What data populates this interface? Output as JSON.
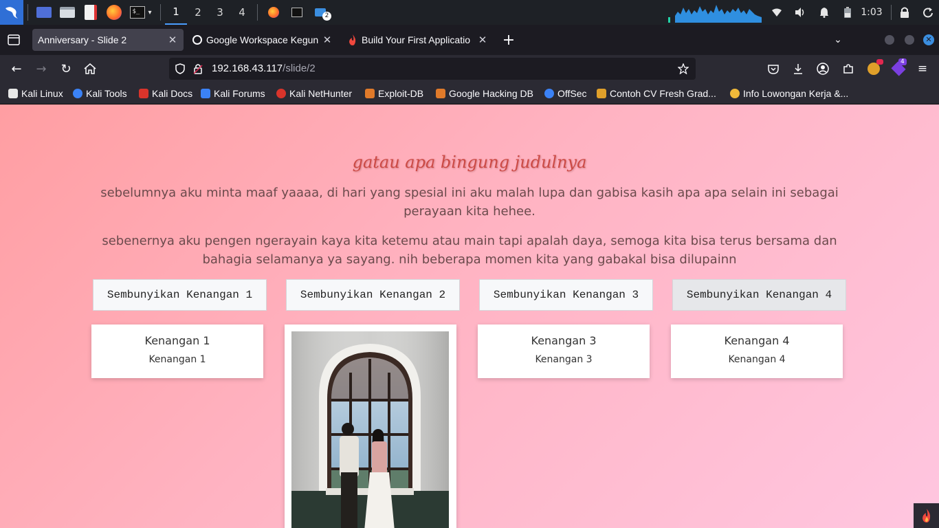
{
  "panel": {
    "workspaces": [
      "1",
      "2",
      "3",
      "4"
    ],
    "active_workspace": "1",
    "files_badge": "2",
    "clock": "1:03"
  },
  "tabs": [
    {
      "title": "Anniversary - Slide 2",
      "active": true,
      "icon": "none"
    },
    {
      "title": "Google Workspace Kegun",
      "active": false,
      "icon": "workspace-icon"
    },
    {
      "title": "Build Your First Applicatio",
      "active": false,
      "icon": "flame-icon"
    }
  ],
  "url": {
    "host": "192.168.43.117",
    "path": "/slide/2"
  },
  "toolbar": {
    "extensions_badge": "4"
  },
  "bookmarks": [
    {
      "label": "Kali Linux",
      "color": "#e8e8e8"
    },
    {
      "label": "Kali Tools",
      "color": "#3b82f6"
    },
    {
      "label": "Kali Docs",
      "color": "#d9342b"
    },
    {
      "label": "Kali Forums",
      "color": "#3b82f6"
    },
    {
      "label": "Kali NetHunter",
      "color": "#d9342b"
    },
    {
      "label": "Exploit-DB",
      "color": "#e07a2a"
    },
    {
      "label": "Google Hacking DB",
      "color": "#e07a2a"
    },
    {
      "label": "OffSec",
      "color": "#3b82f6"
    },
    {
      "label": "Contoh CV Fresh Grad...",
      "color": "#e0a02a"
    },
    {
      "label": "Info Lowongan Kerja &...",
      "color": "#f0b93a"
    }
  ],
  "content": {
    "heading": "gatau apa bingung judulnya",
    "paragraph1": "sebelumnya aku minta maaf yaaaa, di hari yang spesial ini aku malah lupa dan gabisa kasih apa apa selain ini sebagai perayaan kita hehee.",
    "paragraph2": "sebenernya aku pengen ngerayain kaya kita ketemu atau main tapi apalah daya, semoga kita bisa terus bersama dan bahagia selamanya ya sayang. nih beberapa momen kita yang gabakal bisa dilupainn",
    "buttons": [
      "Sembunyikan Kenangan 1",
      "Sembunyikan Kenangan 2",
      "Sembunyikan Kenangan 3",
      "Sembunyikan Kenangan 4"
    ],
    "cards": [
      {
        "title": "Kenangan 1",
        "subtitle": "Kenangan 1"
      },
      {
        "title": "Kenangan 3",
        "subtitle": "Kenangan 3"
      },
      {
        "title": "Kenangan 4",
        "subtitle": "Kenangan 4"
      }
    ]
  }
}
